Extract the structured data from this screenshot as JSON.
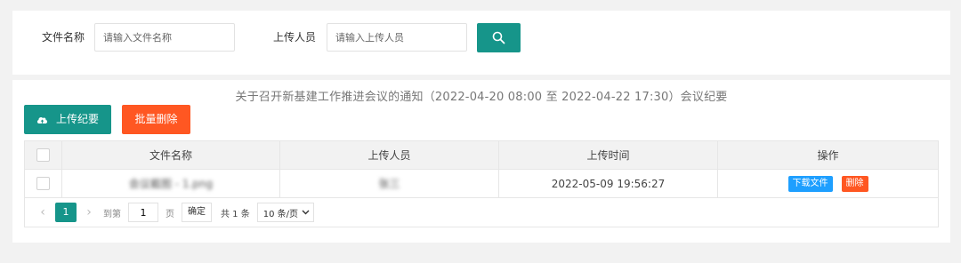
{
  "search": {
    "file_name_label": "文件名称",
    "file_name_placeholder": "请输入文件名称",
    "uploader_label": "上传人员",
    "uploader_placeholder": "请输入上传人员",
    "search_icon": "search-icon"
  },
  "list": {
    "meeting_title": "关于召开新基建工作推进会议的通知（2022-04-20 08:00 至 2022-04-22 17:30）会议纪要",
    "upload_button": "上传纪要",
    "upload_icon": "cloud-upload-icon",
    "batch_delete_button": "批量删除",
    "columns": [
      "文件名称",
      "上传人员",
      "上传时间",
      "操作"
    ],
    "rows": [
      {
        "file_name": "会议截图 - 1.png",
        "uploader": "张三",
        "upload_time": "2022-05-09 19:56:27",
        "download_label": "下载文件",
        "delete_label": "删除"
      }
    ]
  },
  "pagination": {
    "current_page": "1",
    "goto_prefix": "到第",
    "goto_value": "1",
    "goto_suffix": "页",
    "confirm_label": "确定",
    "total_text": "共 1 条",
    "page_size": "10 条/页"
  },
  "colors": {
    "primary": "#16958a",
    "danger": "#ff5722",
    "info": "#1e9fff"
  }
}
